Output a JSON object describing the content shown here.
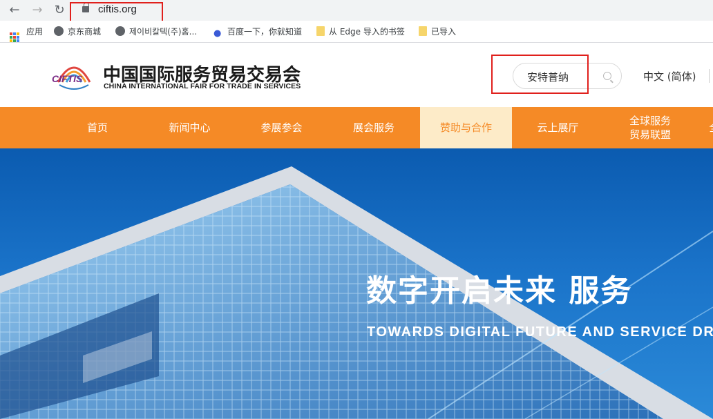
{
  "browser": {
    "url": "ciftis.org",
    "bookmarks": [
      {
        "label": "应用",
        "icon": "apps-grid-icon"
      },
      {
        "label": "京东商城",
        "icon": "globe-icon"
      },
      {
        "label": "제이비칼텍(주)홈...",
        "icon": "globe-icon"
      },
      {
        "label": "百度一下，你就知道",
        "icon": "baidu-paw-icon"
      },
      {
        "label": "从 Edge 导入的书签",
        "icon": "folder-icon"
      },
      {
        "label": "已导入",
        "icon": "folder-icon"
      }
    ]
  },
  "site": {
    "logo_mark_text": "CIFTIS",
    "logo_cn": "中国国际服务贸易交易会",
    "logo_en": "CHINA INTERNATIONAL FAIR FOR TRADE IN SERVICES",
    "search_value": "安特普纳",
    "lang": "中文 (简体)"
  },
  "nav": {
    "items": [
      {
        "label": "首页"
      },
      {
        "label": "新闻中心"
      },
      {
        "label": "参展参会"
      },
      {
        "label": "展会服务"
      },
      {
        "label": "赞助与合作"
      },
      {
        "label": "云上展厅"
      },
      {
        "label": "全球服务\n贸易联盟"
      }
    ],
    "active_index": 4,
    "bar_color": "#f58a26",
    "active_bg": "#fdebc8"
  },
  "banner": {
    "slogan_cn": "数字开启未来  服务",
    "slogan_en": "TOWARDS DIGITAL FUTURE AND SERVICE DR"
  },
  "annotations": {
    "highlight_color": "#e0201c"
  }
}
